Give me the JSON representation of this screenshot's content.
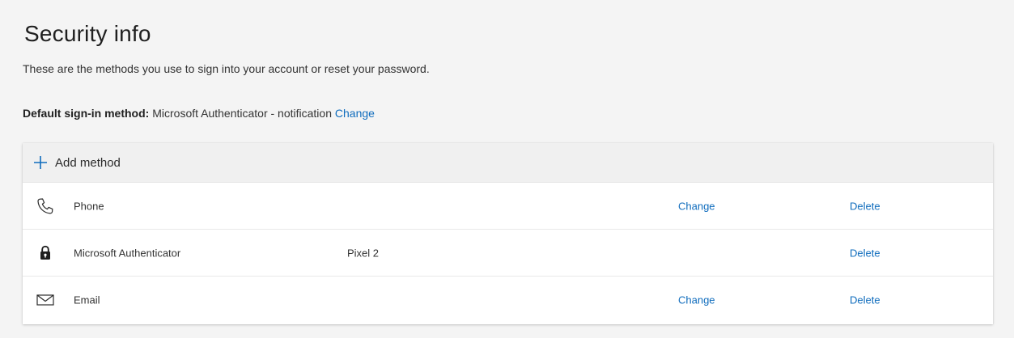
{
  "page": {
    "title": "Security info",
    "subtitle": "These are the methods you use to sign into your account or reset your password."
  },
  "default_method": {
    "label": "Default sign-in method:",
    "value": "Microsoft Authenticator - notification",
    "change_label": "Change"
  },
  "methods_card": {
    "add_label": "Add method",
    "add_icon": "plus-icon",
    "rows": [
      {
        "icon": "phone-icon",
        "name": "Phone",
        "detail": "",
        "change": "Change",
        "delete": "Delete"
      },
      {
        "icon": "lock-icon",
        "name": "Microsoft Authenticator",
        "detail": "Pixel 2",
        "change": "",
        "delete": "Delete"
      },
      {
        "icon": "mail-icon",
        "name": "Email",
        "detail": "",
        "change": "Change",
        "delete": "Delete"
      }
    ]
  },
  "colors": {
    "accent": "#0f6cbd",
    "background": "#f4f4f4",
    "card": "#ffffff",
    "header_row": "#f0f0f0"
  }
}
